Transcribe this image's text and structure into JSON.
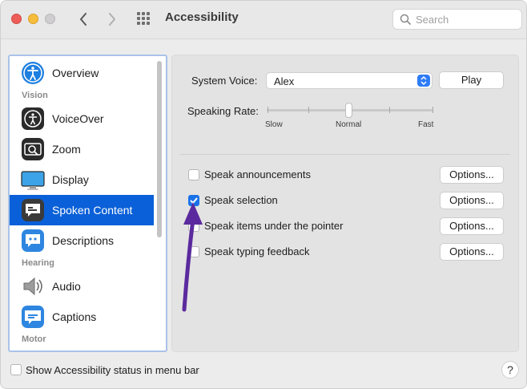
{
  "window": {
    "title": "Accessibility",
    "search_placeholder": "Search",
    "icons": {
      "back": "chevron-left-icon",
      "forward": "chevron-right-icon",
      "grid": "grid-icon",
      "search": "search-icon"
    }
  },
  "sidebar": {
    "headers": {
      "vision": "Vision",
      "hearing": "Hearing",
      "motor": "Motor"
    },
    "items": [
      {
        "label": "Overview",
        "icon": "accessibility-icon"
      },
      {
        "label": "VoiceOver",
        "icon": "voiceover-icon"
      },
      {
        "label": "Zoom",
        "icon": "zoom-icon"
      },
      {
        "label": "Display",
        "icon": "display-icon"
      },
      {
        "label": "Spoken Content",
        "icon": "speech-bubble-icon",
        "selected": true
      },
      {
        "label": "Descriptions",
        "icon": "descriptions-icon"
      },
      {
        "label": "Audio",
        "icon": "speaker-icon"
      },
      {
        "label": "Captions",
        "icon": "captions-icon"
      }
    ]
  },
  "main": {
    "system_voice_label": "System Voice:",
    "system_voice_value": "Alex",
    "play_label": "Play",
    "speaking_rate_label": "Speaking Rate:",
    "rate_ticks": {
      "slow": "Slow",
      "normal": "Normal",
      "fast": "Fast"
    },
    "rate_level": 0.5,
    "options": [
      {
        "label": "Speak announcements",
        "checked": false,
        "button": "Options..."
      },
      {
        "label": "Speak selection",
        "checked": true,
        "button": "Options..."
      },
      {
        "label": "Speak items under the pointer",
        "checked": false,
        "button": "Options..."
      },
      {
        "label": "Speak typing feedback",
        "checked": false,
        "button": "Options..."
      }
    ]
  },
  "footer": {
    "status_label": "Show Accessibility status in menu bar",
    "status_checked": false,
    "help_label": "?"
  },
  "colors": {
    "accent": "#0a60d8",
    "annotation_arrow": "#5b2a9e"
  }
}
